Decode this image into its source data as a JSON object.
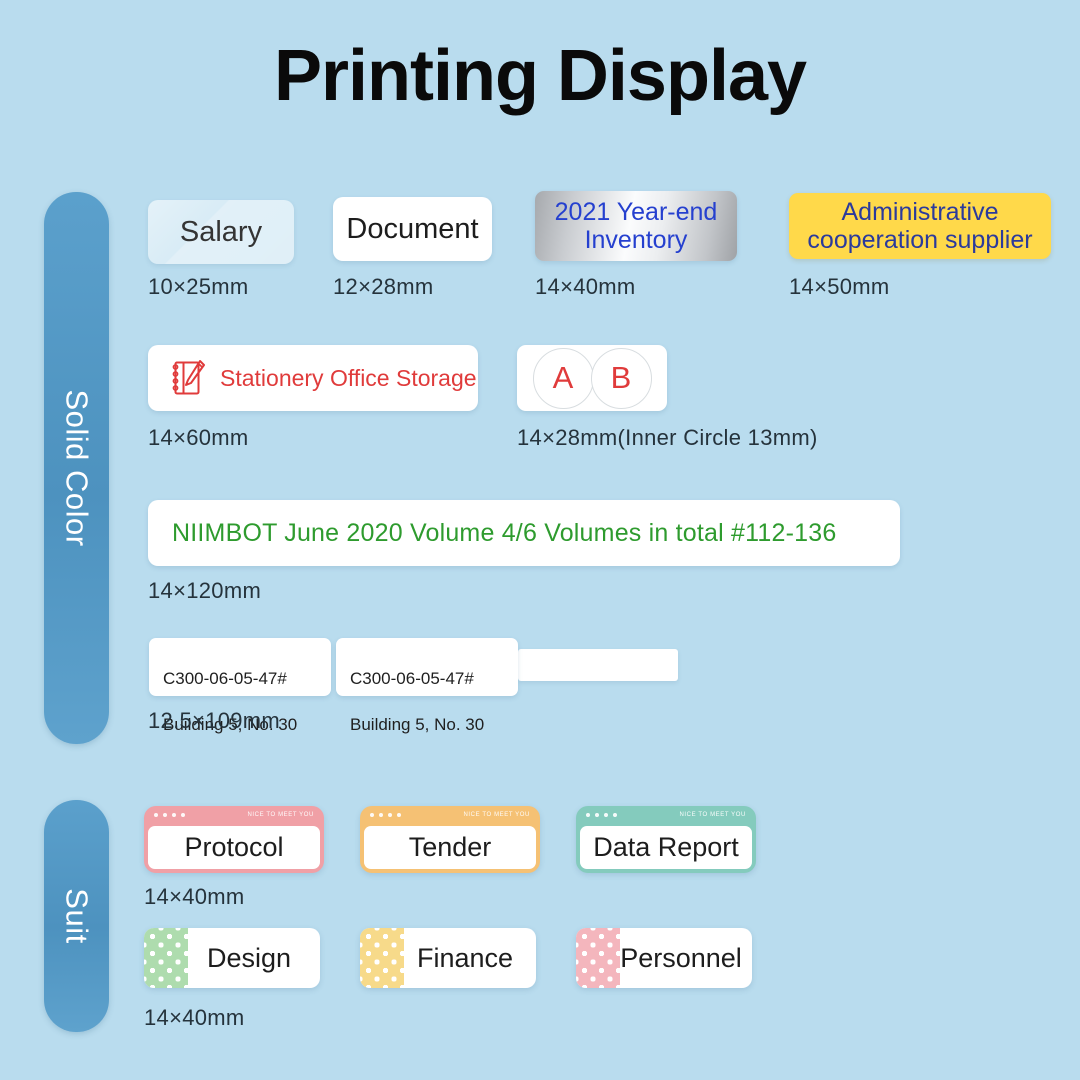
{
  "page": {
    "title": "Printing Display",
    "background_color": "#b9dcee"
  },
  "sections": [
    {
      "key": "solid_color",
      "label": "Solid Color",
      "tab_color": "#4d92bf"
    },
    {
      "key": "suit",
      "label": "Suit",
      "tab_color": "#4d92bf"
    }
  ],
  "solid_color": {
    "row1": [
      {
        "name": "salary",
        "text": "Salary",
        "size": "10×25mm",
        "style": "transparent",
        "text_color": "#343434"
      },
      {
        "name": "document",
        "text": "Document",
        "size": "12×28mm",
        "style": "white",
        "text_color": "#1d1d1d"
      },
      {
        "name": "inventory",
        "line1": "2021 Year-end",
        "line2": "Inventory",
        "size": "14×40mm",
        "style": "silver",
        "text_color": "#2540cf"
      },
      {
        "name": "administrative",
        "line1": "Administrative",
        "line2": "cooperation supplier",
        "size": "14×50mm",
        "style": "yellow",
        "bg_color": "#ffd94a",
        "text_color": "#2b3a9c"
      }
    ],
    "row2": [
      {
        "name": "stationery",
        "text": "Stationery Office Storage",
        "size": "14×60mm",
        "icon": "notebook-pencil-icon",
        "text_color": "#e03b3b"
      },
      {
        "name": "ab_circles",
        "circle_a": "A",
        "circle_b": "B",
        "size": "14×28mm(Inner Circle  13mm)",
        "text_color": "#e03b3b"
      }
    ],
    "row3": [
      {
        "name": "niimbot",
        "text": "NIIMBOT June 2020 Volume 4/6 Volumes in total #112-136",
        "size": "14×120mm",
        "text_color": "#2e9b2e"
      }
    ],
    "row4": [
      {
        "name": "cable_flag",
        "line1": "C300-06-05-47#",
        "line2": "Building 5, No. 30",
        "size": "12.5×109mm"
      }
    ]
  },
  "suit": {
    "banner_row": {
      "size": "14×40mm",
      "items": [
        {
          "name": "protocol",
          "text": "Protocol",
          "band_color": "#f0a0a6",
          "band_text": "NICE TO MEET YOU"
        },
        {
          "name": "tender",
          "text": "Tender",
          "band_color": "#f5c174",
          "band_text": "NICE TO MEET YOU"
        },
        {
          "name": "data_report",
          "text": "Data Report",
          "band_color": "#84cbbd",
          "band_text": "NICE TO MEET YOU"
        }
      ]
    },
    "dot_row": {
      "size": "14×40mm",
      "items": [
        {
          "name": "design",
          "text": "Design",
          "patch_color": "#aedcae"
        },
        {
          "name": "finance",
          "text": "Finance",
          "patch_color": "#f7da8a"
        },
        {
          "name": "personnel",
          "text": "Personnel",
          "patch_color": "#f4b6bd"
        }
      ]
    }
  }
}
